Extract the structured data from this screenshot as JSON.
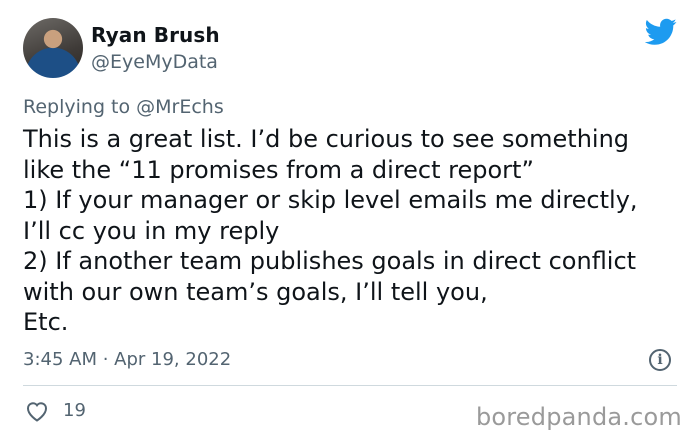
{
  "author": {
    "name": "Ryan Brush",
    "handle": "@EyeMyData",
    "avatar": "profile-photo"
  },
  "reply": {
    "prefix": "Replying to ",
    "handle": "@MrEchs"
  },
  "tweet_text": "This is a great list. I’d be curious to see something\nlike the “11 promises from a direct report”\n1) If your manager or skip level emails me directly,\nI’ll cc you in my reply\n2) If another team publishes goals in direct conflict\nwith our own team’s goals, I’ll tell you,\nEtc.",
  "timestamp": "3:45 AM · Apr 19, 2022",
  "info_icon_glyph": "i",
  "likes": "19",
  "watermark": "boredpanda.com",
  "colors": {
    "brand": "#1d9bf0",
    "text": "#0f1419",
    "muted": "#536471",
    "divider": "#cfd9de"
  },
  "icons": [
    "twitter-bird-icon",
    "info-icon",
    "heart-icon"
  ]
}
